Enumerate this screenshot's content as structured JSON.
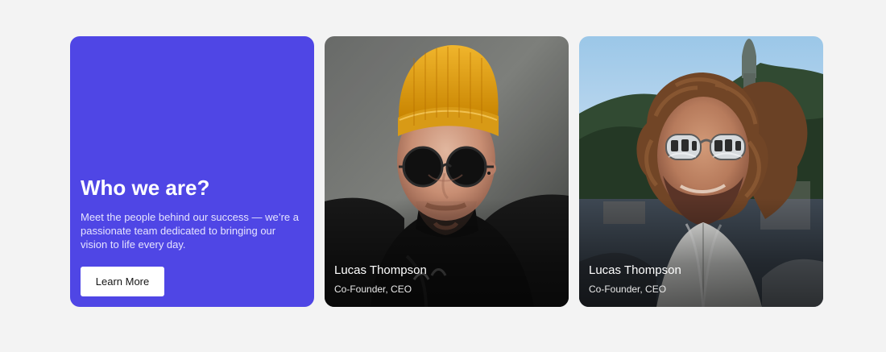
{
  "intro": {
    "title": "Who we are?",
    "description": "Meet the people behind our success — we’re a passionate team dedicated to bringing our vision to life every day.",
    "button_label": "Learn More",
    "background_color": "#4f46e5"
  },
  "team": [
    {
      "name": "Lucas Thompson",
      "role": "Co-Founder, CEO"
    },
    {
      "name": "Lucas Thompson",
      "role": "Co-Founder, CEO"
    }
  ]
}
